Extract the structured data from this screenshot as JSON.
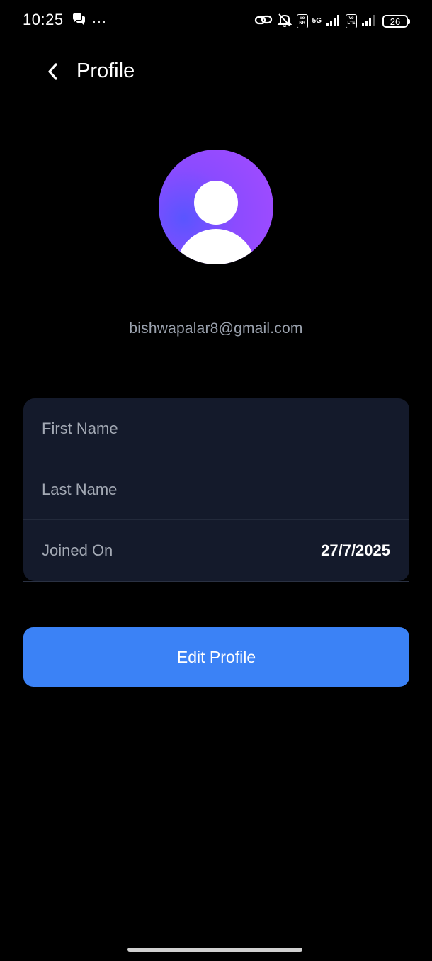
{
  "status_bar": {
    "time": "10:25",
    "dots": "···",
    "network_badge_1": [
      "Vo",
      "NR"
    ],
    "network_5g": "5G",
    "network_badge_2": [
      "Vo",
      "LTE"
    ],
    "battery": "26"
  },
  "header": {
    "title": "Profile"
  },
  "profile": {
    "email": "bishwapalar8@gmail.com"
  },
  "details": {
    "first_name_label": "First Name",
    "first_name_value": "",
    "last_name_label": "Last Name",
    "last_name_value": "",
    "joined_label": "Joined On",
    "joined_value": "27/7/2025"
  },
  "actions": {
    "edit_profile_label": "Edit Profile"
  },
  "colors": {
    "background": "#000000",
    "card": "#141a2b",
    "accent": "#3b82f6",
    "avatar_gradient": [
      "#5a55ff",
      "#a64bff"
    ],
    "muted_text": "#9aa1ad"
  },
  "icons": [
    "chat-icon",
    "link-icon",
    "bell-off-icon",
    "signal-icon",
    "battery-icon",
    "back-chevron-icon",
    "user-avatar-icon"
  ]
}
